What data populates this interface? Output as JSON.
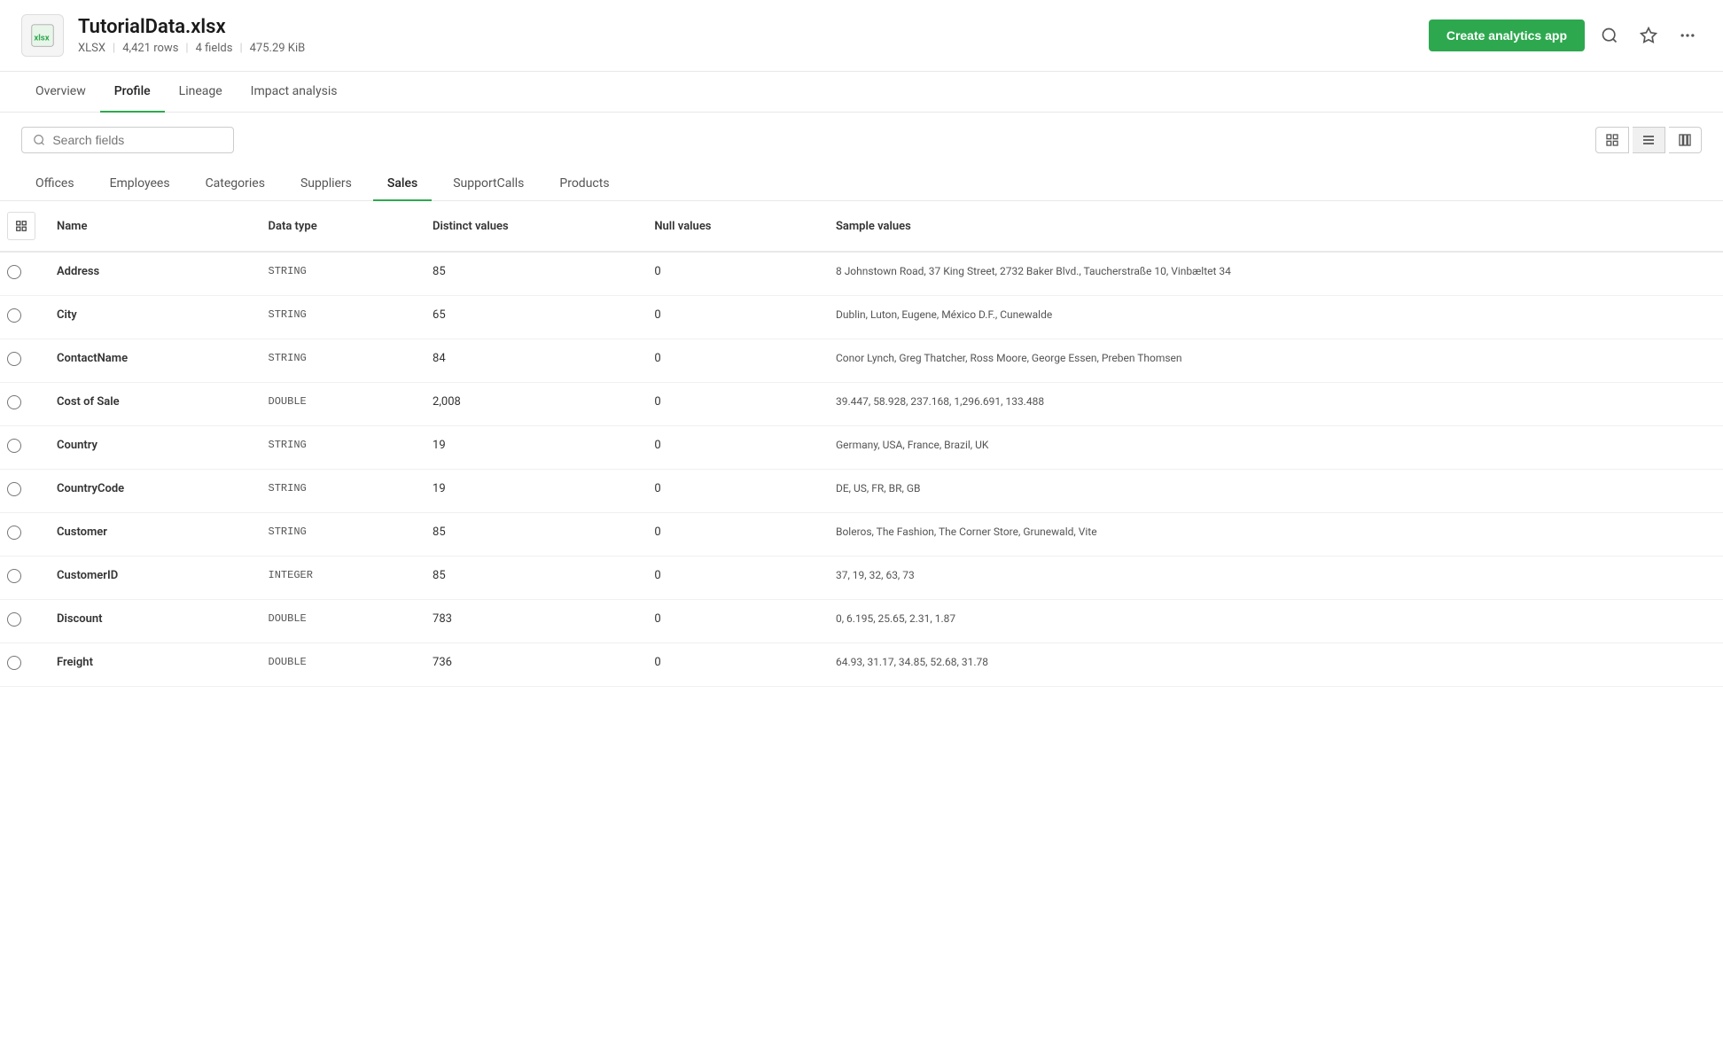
{
  "header": {
    "file_name": "TutorialData.xlsx",
    "file_type": "XLSX",
    "rows": "4,421 rows",
    "fields": "4 fields",
    "size": "475.29 KiB",
    "create_btn": "Create analytics app"
  },
  "tabs": [
    {
      "id": "overview",
      "label": "Overview",
      "active": false
    },
    {
      "id": "profile",
      "label": "Profile",
      "active": true
    },
    {
      "id": "lineage",
      "label": "Lineage",
      "active": false
    },
    {
      "id": "impact",
      "label": "Impact analysis",
      "active": false
    }
  ],
  "search": {
    "placeholder": "Search fields",
    "value": ""
  },
  "subtabs": [
    {
      "id": "offices",
      "label": "Offices",
      "active": false
    },
    {
      "id": "employees",
      "label": "Employees",
      "active": false
    },
    {
      "id": "categories",
      "label": "Categories",
      "active": false
    },
    {
      "id": "suppliers",
      "label": "Suppliers",
      "active": false
    },
    {
      "id": "sales",
      "label": "Sales",
      "active": true
    },
    {
      "id": "supportcalls",
      "label": "SupportCalls",
      "active": false
    },
    {
      "id": "products",
      "label": "Products",
      "active": false
    }
  ],
  "table": {
    "columns": [
      {
        "id": "checkbox",
        "label": ""
      },
      {
        "id": "name",
        "label": "Name"
      },
      {
        "id": "data_type",
        "label": "Data type"
      },
      {
        "id": "distinct_values",
        "label": "Distinct values"
      },
      {
        "id": "null_values",
        "label": "Null values"
      },
      {
        "id": "sample_values",
        "label": "Sample values"
      }
    ],
    "rows": [
      {
        "name": "Address",
        "data_type": "STRING",
        "distinct_values": "85",
        "null_values": "0",
        "sample_values": "8 Johnstown Road, 37 King Street, 2732 Baker Blvd., Taucherstraße 10, Vinbæltet 34"
      },
      {
        "name": "City",
        "data_type": "STRING",
        "distinct_values": "65",
        "null_values": "0",
        "sample_values": "Dublin, Luton, Eugene, México D.F., Cunewalde"
      },
      {
        "name": "ContactName",
        "data_type": "STRING",
        "distinct_values": "84",
        "null_values": "0",
        "sample_values": "Conor Lynch, Greg Thatcher, Ross Moore, George Essen, Preben Thomsen"
      },
      {
        "name": "Cost of Sale",
        "data_type": "DOUBLE",
        "distinct_values": "2,008",
        "null_values": "0",
        "sample_values": "39.447, 58.928, 237.168, 1,296.691, 133.488"
      },
      {
        "name": "Country",
        "data_type": "STRING",
        "distinct_values": "19",
        "null_values": "0",
        "sample_values": "Germany, USA, France, Brazil, UK"
      },
      {
        "name": "CountryCode",
        "data_type": "STRING",
        "distinct_values": "19",
        "null_values": "0",
        "sample_values": "DE, US, FR, BR, GB"
      },
      {
        "name": "Customer",
        "data_type": "STRING",
        "distinct_values": "85",
        "null_values": "0",
        "sample_values": "Boleros, The Fashion, The Corner Store, Grunewald, Vite"
      },
      {
        "name": "CustomerID",
        "data_type": "INTEGER",
        "distinct_values": "85",
        "null_values": "0",
        "sample_values": "37, 19, 32, 63, 73"
      },
      {
        "name": "Discount",
        "data_type": "DOUBLE",
        "distinct_values": "783",
        "null_values": "0",
        "sample_values": "0, 6.195, 25.65, 2.31, 1.87"
      },
      {
        "name": "Freight",
        "data_type": "DOUBLE",
        "distinct_values": "736",
        "null_values": "0",
        "sample_values": "64.93, 31.17, 34.85, 52.68, 31.78"
      }
    ]
  }
}
